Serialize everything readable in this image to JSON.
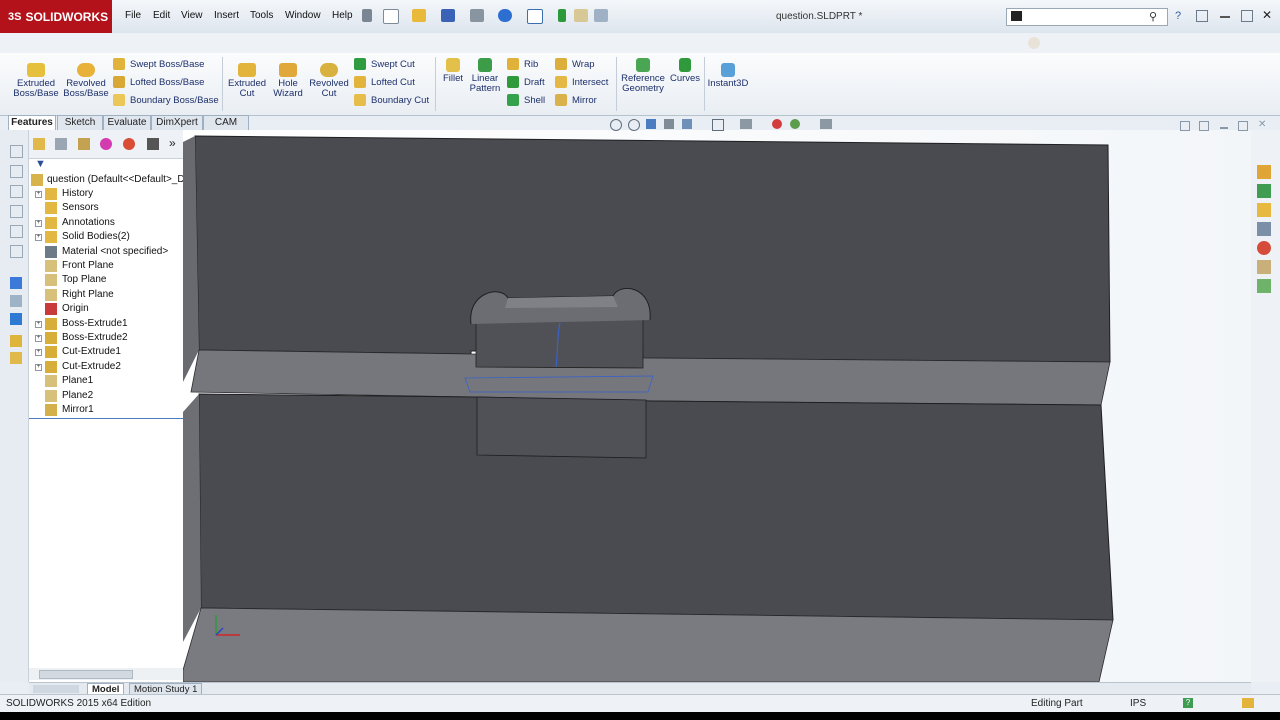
{
  "app": {
    "brand": "SOLIDWORKS",
    "menu": [
      "File",
      "Edit",
      "View",
      "Insert",
      "Tools",
      "Window",
      "Help"
    ],
    "document_title": "question.SLDPRT *",
    "search_placeholder": "",
    "help_label": "?"
  },
  "ribbon": {
    "big": [
      {
        "label": "Extruded\nBoss/Base",
        "icon": "extruded-boss-icon"
      },
      {
        "label": "Revolved\nBoss/Base",
        "icon": "revolved-boss-icon"
      },
      {
        "label": "Extruded\nCut",
        "icon": "extruded-cut-icon"
      },
      {
        "label": "Hole\nWizard",
        "icon": "hole-wizard-icon"
      },
      {
        "label": "Revolved\nCut",
        "icon": "revolved-cut-icon"
      },
      {
        "label": "Fillet",
        "icon": "fillet-icon"
      },
      {
        "label": "Linear\nPattern",
        "icon": "linear-pattern-icon"
      },
      {
        "label": "Reference\nGeometry",
        "icon": "reference-geometry-icon"
      },
      {
        "label": "Curves",
        "icon": "curves-icon"
      },
      {
        "label": "Instant3D",
        "icon": "instant3d-icon"
      }
    ],
    "boss_small": [
      "Swept Boss/Base",
      "Lofted Boss/Base",
      "Boundary Boss/Base"
    ],
    "cut_small": [
      "Swept Cut",
      "Lofted Cut",
      "Boundary Cut"
    ],
    "feature_small": [
      "Rib",
      "Draft",
      "Shell"
    ],
    "other_small": [
      "Wrap",
      "Intersect",
      "Mirror"
    ]
  },
  "tabs": [
    "Features",
    "Sketch",
    "Evaluate",
    "DimXpert",
    "CAM"
  ],
  "active_tab": "Features",
  "tree": {
    "root": "question  (Default<<Default>_D",
    "items": [
      {
        "label": "History",
        "expandable": true,
        "icon": "history-icon"
      },
      {
        "label": "Sensors",
        "expandable": false,
        "icon": "sensors-icon"
      },
      {
        "label": "Annotations",
        "expandable": true,
        "icon": "annotations-icon"
      },
      {
        "label": "Solid Bodies(2)",
        "expandable": true,
        "icon": "solid-bodies-icon"
      },
      {
        "label": "Material <not specified>",
        "expandable": false,
        "icon": "material-icon"
      },
      {
        "label": "Front Plane",
        "expandable": false,
        "icon": "plane-icon"
      },
      {
        "label": "Top Plane",
        "expandable": false,
        "icon": "plane-icon"
      },
      {
        "label": "Right Plane",
        "expandable": false,
        "icon": "plane-icon"
      },
      {
        "label": "Origin",
        "expandable": false,
        "icon": "origin-icon"
      },
      {
        "label": "Boss-Extrude1",
        "expandable": true,
        "icon": "boss-extrude-icon"
      },
      {
        "label": "Boss-Extrude2",
        "expandable": true,
        "icon": "boss-extrude-icon"
      },
      {
        "label": "Cut-Extrude1",
        "expandable": true,
        "icon": "cut-extrude-icon"
      },
      {
        "label": "Cut-Extrude2",
        "expandable": true,
        "icon": "cut-extrude-icon"
      },
      {
        "label": "Plane1",
        "expandable": false,
        "icon": "plane-icon"
      },
      {
        "label": "Plane2",
        "expandable": false,
        "icon": "plane-icon"
      },
      {
        "label": "Mirror1",
        "expandable": false,
        "icon": "mirror-icon"
      }
    ]
  },
  "bottom_tabs": [
    "Model",
    "Motion Study 1"
  ],
  "status": {
    "edition": "SOLIDWORKS 2015 x64 Edition",
    "mode": "Editing Part",
    "units": "IPS"
  },
  "colors": {
    "brand_red": "#b3121b",
    "part_face": "#4a4b50",
    "part_top": "#76777c",
    "sketch_blue": "#3a62c8",
    "ribbon_text": "#1c2f6b"
  }
}
